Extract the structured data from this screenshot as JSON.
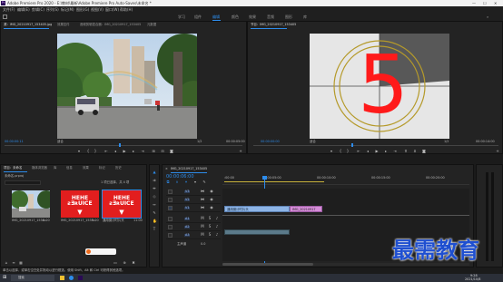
{
  "app": {
    "title": "Adobe Premiere Pro 2020 - E:\\教材\\最新\\Adobe Premiere Pro Auto-Saves\\未命名 *",
    "window_controls": [
      "—",
      "☐",
      "✕"
    ]
  },
  "menu": [
    "文件(F)",
    "编辑(E)",
    "剪辑(C)",
    "序列(S)",
    "标记(M)",
    "图形(G)",
    "视图(V)",
    "窗口(W)",
    "帮助(H)"
  ],
  "workspaces": {
    "items": [
      "学习",
      "组件",
      "编辑",
      "颜色",
      "效果",
      "音频",
      "图形",
      "库"
    ],
    "active_index": 2
  },
  "source_monitor": {
    "tabs": [
      "源：IMG_20210917_153405.jpg",
      "效果控件",
      "音频剪辑混合器：IMG_20210917_153405",
      "元数据"
    ],
    "timecode_left": "00:00:00:11",
    "timecode_right": "00:00:05:00",
    "fit": "适合",
    "fraction": "1/2"
  },
  "program_monitor": {
    "tabs": [
      "节目：IMG_20210917_153405"
    ],
    "timecode_left": "00:00:00:00",
    "timecode_right": "00:00:14:00",
    "fit": "适合",
    "fraction": "1/2",
    "countdown_number": "5"
  },
  "project_panel": {
    "tabs": [
      "项目：未命名",
      "媒体浏览器",
      "库",
      "信息",
      "效果",
      "标记",
      "历史"
    ],
    "project_file": "未命名.prproj",
    "selection_info": "1 项已选择，共 4 项",
    "items": [
      {
        "name": "IMG_20210917_1534...",
        "duration": "5:00"
      },
      {
        "name": "IMG_20210917_1533...",
        "duration": "5:00"
      },
      {
        "name": "通用倒计时片头",
        "duration": "11:00"
      }
    ],
    "thumb_text": "HEHE ƨƎʀUICE"
  },
  "timeline": {
    "tab": "IMG_20210917_153405",
    "timecode": "00:00:06:00",
    "ruler_marks": [
      ":00:00",
      "00:00:05:00",
      "00:00:10:00",
      "00:00:15:00",
      "00:00:20:00"
    ],
    "tracks": [
      "V3",
      "V2",
      "V1",
      "A1",
      "A2",
      "A3"
    ],
    "master_label": "主声道",
    "master_value": "0.0",
    "clips": [
      {
        "track": "V1",
        "label": "通用倒计时片头",
        "kind": "video"
      },
      {
        "track": "V1",
        "label": "IMG_20210917",
        "kind": "image"
      }
    ]
  },
  "status_bar": {
    "text": "单击以选择，或单击空白处并拖动以进行框选。使用 Shift、Alt 和 Ctrl 可获得其他选项。"
  },
  "taskbar": {
    "search": "搜索",
    "time": "9:28",
    "date": "2021/10/8"
  },
  "watermark": {
    "text": "最需教育"
  },
  "colors": {
    "accent": "#2d8ceb",
    "countdown_red": "#ff1a1a",
    "ring_gold": "#b59a2a",
    "video_clip": "#8db4e6",
    "image_clip": "#d58cd8",
    "watermark_blue": "#1f4fd0"
  }
}
